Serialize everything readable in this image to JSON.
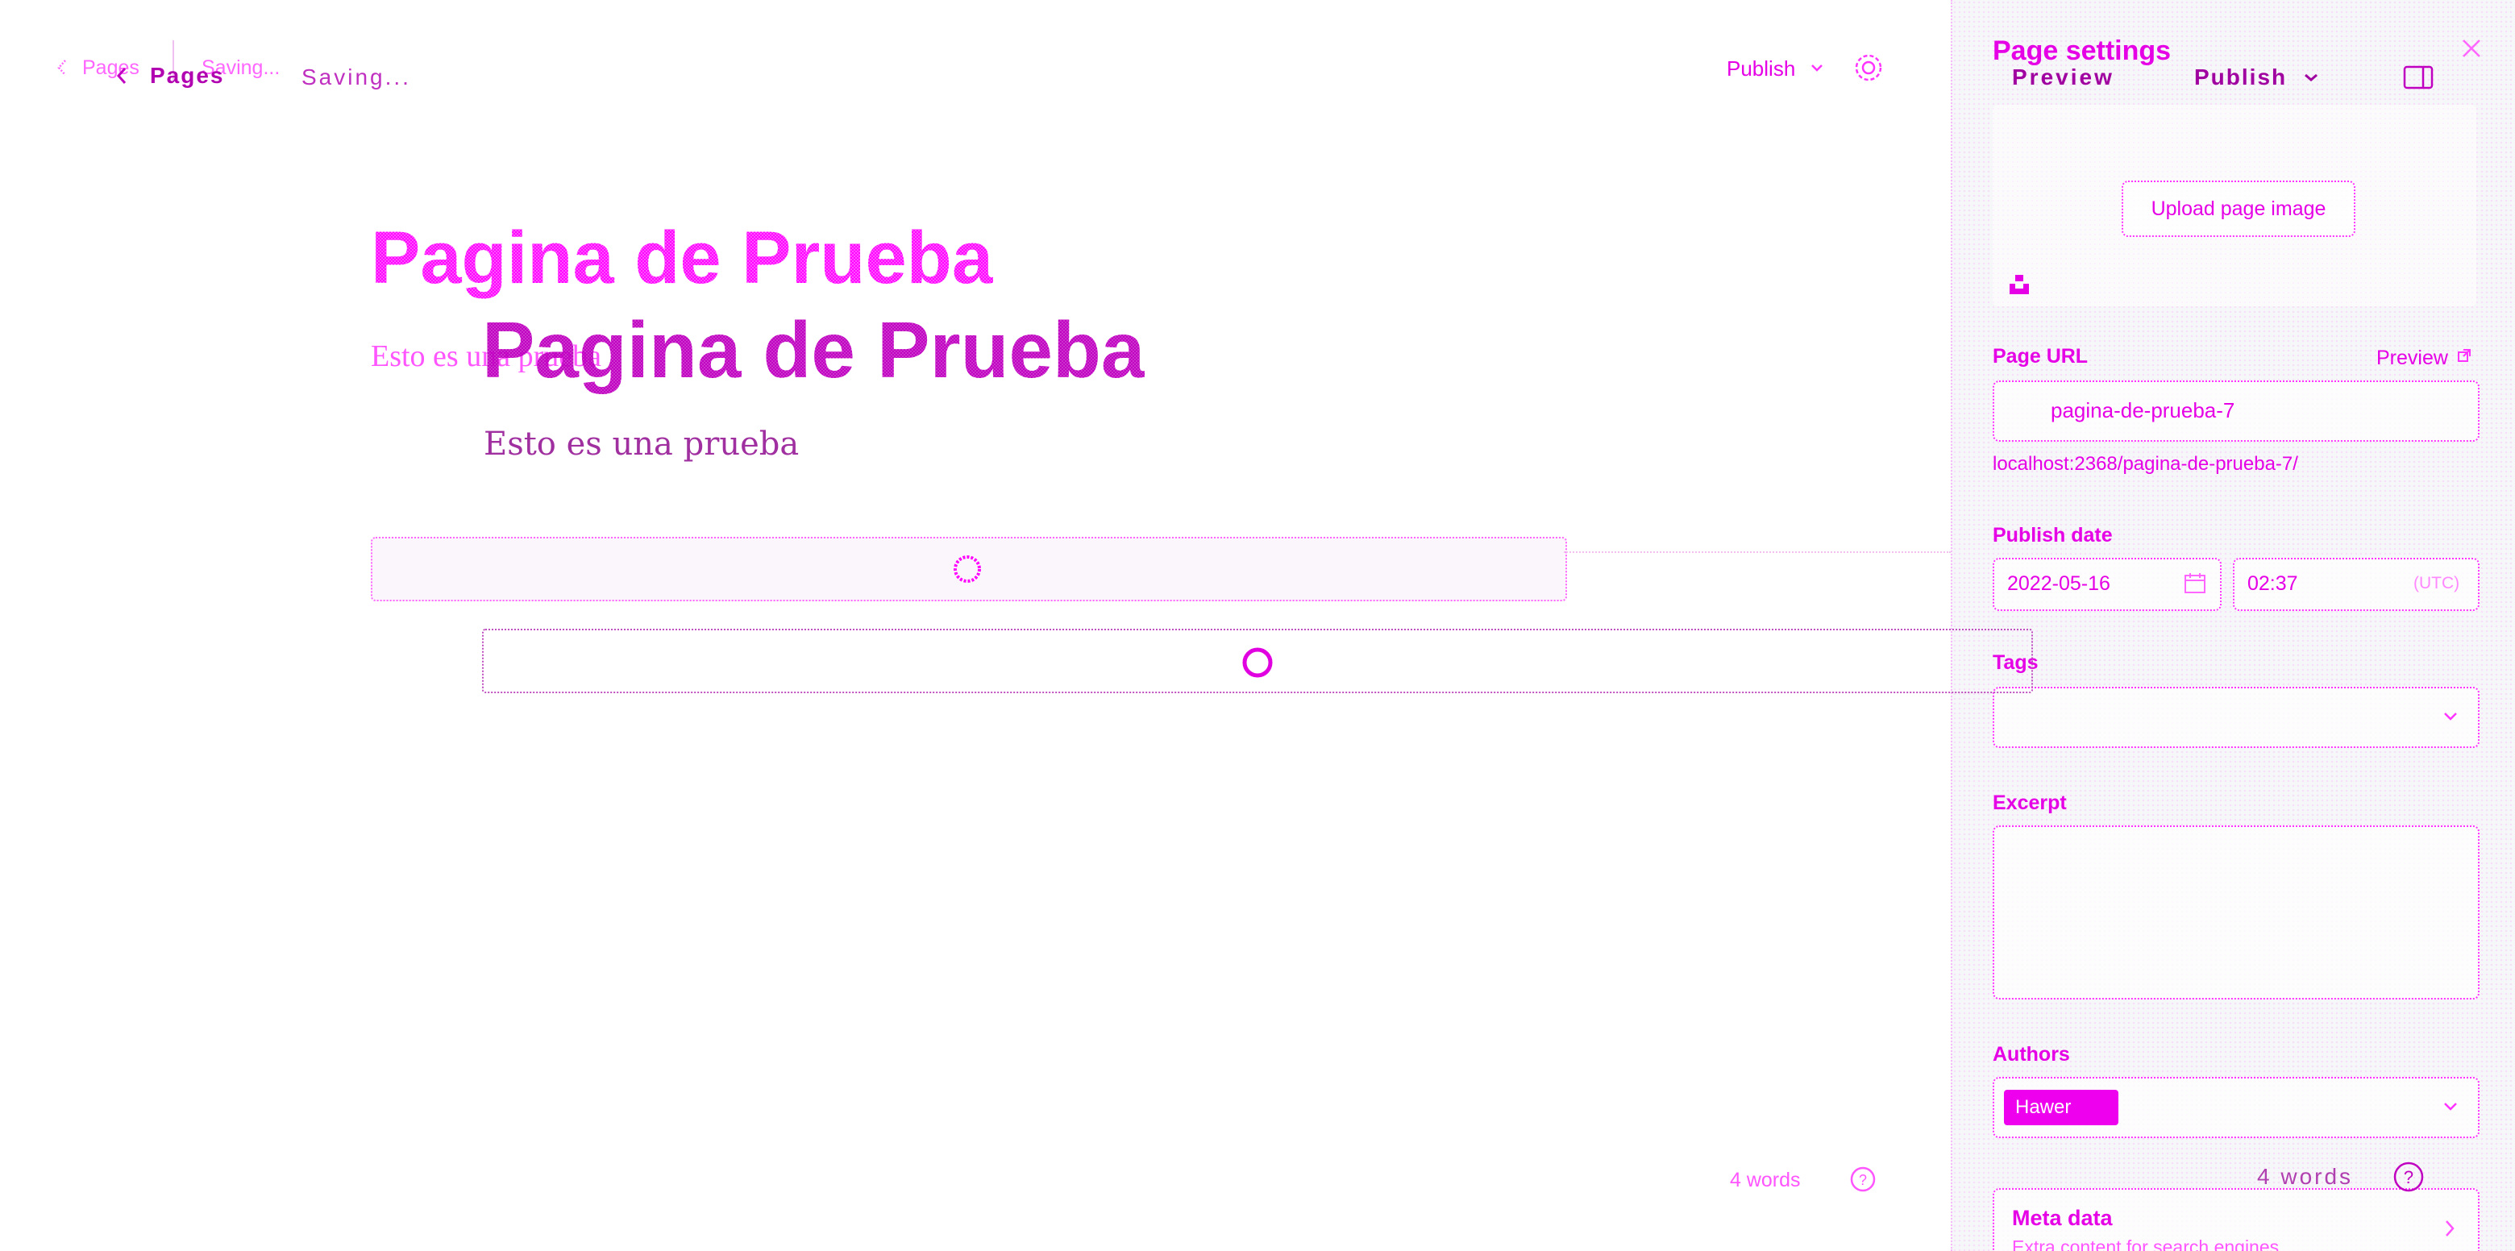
{
  "header": {
    "back_label": "Pages",
    "status": "Saving...",
    "publish_label": "Publish",
    "preview_label": "Preview"
  },
  "editor": {
    "title": "Pagina de Prueba",
    "subtitle": "Esto es una prueba",
    "word_count": "4 words"
  },
  "settings": {
    "title": "Page settings",
    "upload_label": "Upload page image",
    "url_label": "Page URL",
    "url_preview": "Preview",
    "url_value": "pagina-de-prueba-7",
    "url_full": "localhost:2368/pagina-de-prueba-7/",
    "date_label": "Publish date",
    "date_value": "2022-05-16",
    "time_value": "02:37",
    "timezone": "(UTC)",
    "tags_label": "Tags",
    "excerpt_label": "Excerpt",
    "authors_label": "Authors",
    "author_chip": "Hawer",
    "meta_title": "Meta data",
    "meta_desc": "Extra content for search engines"
  },
  "colors": {
    "accent": "#ff00ff",
    "accent_dark": "#c000c0"
  }
}
